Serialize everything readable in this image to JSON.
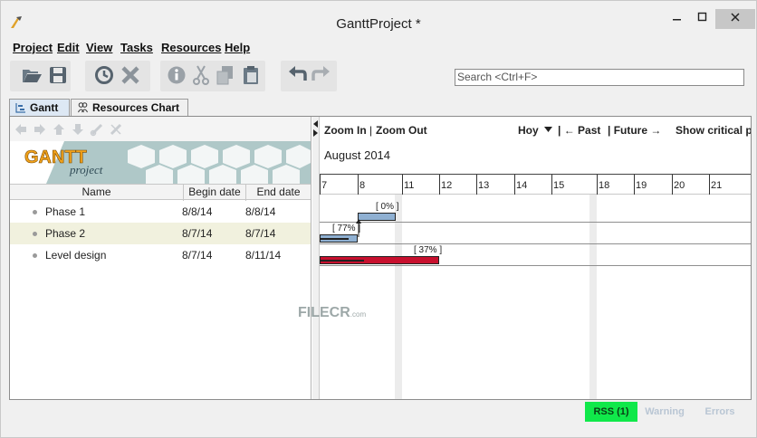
{
  "window": {
    "title": "GanttProject *"
  },
  "menu": {
    "items": [
      "Project",
      "Edit",
      "View",
      "Tasks",
      "Resources",
      "Help"
    ]
  },
  "toolbar": {
    "buttons": [
      "open-icon",
      "save-icon",
      "history-icon",
      "delete-icon",
      "properties-icon",
      "cut-icon",
      "copy-icon",
      "paste-icon",
      "undo-icon",
      "redo-icon"
    ],
    "search_placeholder": "Search <Ctrl+F>"
  },
  "tabs": [
    {
      "label": "Gantt",
      "active": true
    },
    {
      "label": "Resources Chart",
      "active": false
    }
  ],
  "banner": {
    "logo": "GANTT",
    "logo_sub": "project"
  },
  "table": {
    "columns": [
      "Name",
      "Begin date",
      "End date"
    ],
    "rows": [
      {
        "name": "Phase 1",
        "begin": "8/8/14",
        "end": "8/8/14"
      },
      {
        "name": "Phase 2",
        "begin": "8/7/14",
        "end": "8/7/14"
      },
      {
        "name": "Level design",
        "begin": "8/7/14",
        "end": "8/11/14"
      }
    ]
  },
  "chart_toolbar": {
    "zoom_in": "Zoom In",
    "zoom_sep": "|",
    "zoom_out": "Zoom Out",
    "today": "Hoy",
    "past": "| ← Past",
    "future": "| Future →",
    "critical": "Show critical pa"
  },
  "timeline": {
    "month": "August 2014",
    "days": [
      "7",
      "8",
      "11",
      "12",
      "13",
      "14",
      "15",
      "18",
      "19",
      "20",
      "21"
    ]
  },
  "bars": [
    {
      "task": "Phase 1",
      "label": "[ 0% ]",
      "progress": 0,
      "color": "#8fb0d2"
    },
    {
      "task": "Phase 2",
      "label": "[ 77% ]",
      "progress": 77,
      "color": "#8fb0d2"
    },
    {
      "task": "Level design",
      "label": "[ 37% ]",
      "progress": 37,
      "color": "#c8102e"
    }
  ],
  "watermark": {
    "text": "FILECR",
    "sub": ".com"
  },
  "status": {
    "rss": "RSS (1)",
    "warning": "Warning",
    "errors": "Errors"
  },
  "colors": {
    "rss_bg": "#10e84a",
    "alt_row": "#f1f1de",
    "gantt_tab": "#dde8f4"
  }
}
